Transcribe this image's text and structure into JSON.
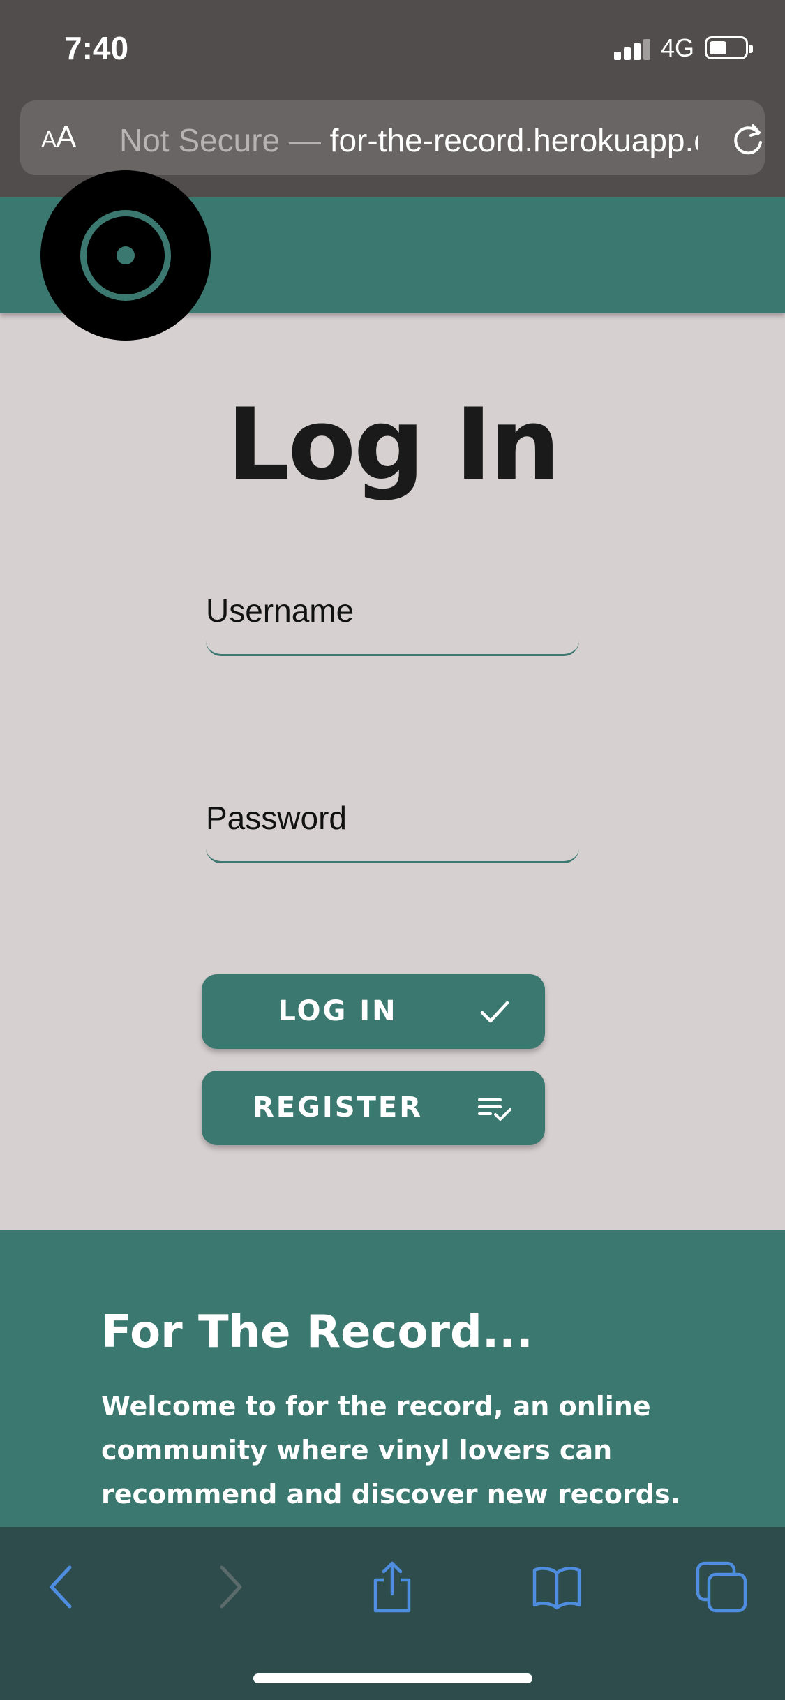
{
  "status_bar": {
    "time": "7:40",
    "network": "4G"
  },
  "browser": {
    "aa_small": "A",
    "aa_large": "A",
    "security_label": "Not Secure —",
    "url": " for-the-record.herokuapp.com"
  },
  "login": {
    "title": "Log In",
    "username_placeholder": "Username",
    "password_placeholder": "Password",
    "login_button": "LOG IN",
    "register_button": "REGISTER"
  },
  "about": {
    "heading": "For The Record...",
    "text": "Welcome to for the record, an online community where vinyl lovers can recommend and discover new records."
  },
  "colors": {
    "brand": "#3b7870",
    "page_bg": "#d7d0d1",
    "browser_chrome": "#524d4d",
    "toolbar_bg": "#2e4c4b",
    "toolbar_icon": "#4f8de0"
  }
}
